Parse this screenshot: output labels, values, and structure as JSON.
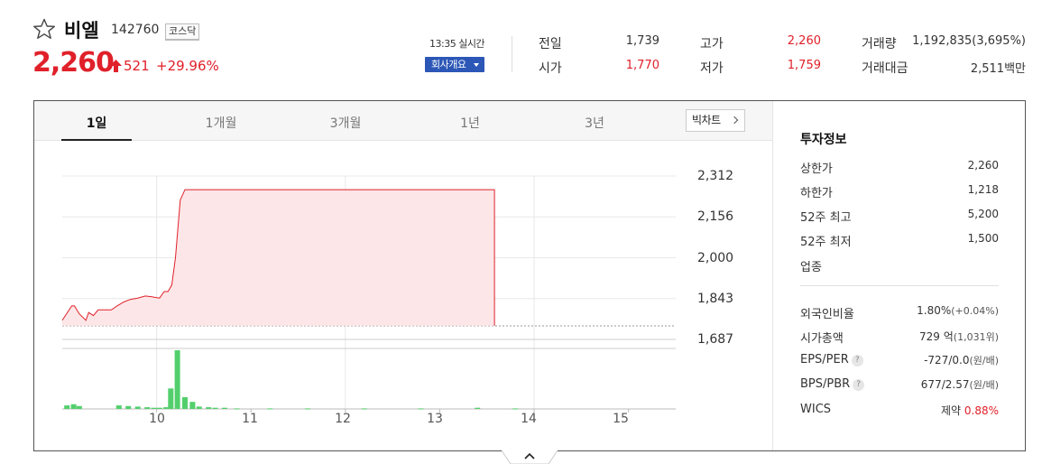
{
  "stock": {
    "name": "비엘",
    "code": "142760",
    "market": "코스닥",
    "price": "2,260",
    "change": "521",
    "change_rate": "+29.96%",
    "time": "13:35 실시간",
    "company_button": "회사개요"
  },
  "summary": {
    "prev_close_label": "전일",
    "prev_close": "1,739",
    "open_label": "시가",
    "open": "1,770",
    "high_label": "고가",
    "high": "2,260",
    "low_label": "저가",
    "low": "1,759",
    "volume_label": "거래량",
    "volume": "1,192,835(3,695%)",
    "amount_label": "거래대금",
    "amount": "2,511백만"
  },
  "tabs": [
    "1일",
    "1개월",
    "3개월",
    "1년",
    "3년"
  ],
  "bigchart_label": "빅차트",
  "colors": {
    "up": "#e0202a",
    "down": "#2354c8",
    "accent": "#2c57b7",
    "volume": "#52cf6c"
  },
  "chart_data": {
    "type": "line",
    "title": "",
    "xlabel": "",
    "ylabel": "",
    "y_ticks": [
      "2,312",
      "2,156",
      "2,000",
      "1,843",
      "1,687"
    ],
    "x_ticks": [
      "10",
      "11",
      "12",
      "13",
      "14",
      "15"
    ],
    "ylim": [
      1687,
      2312
    ],
    "xlim_hours": [
      9.0,
      15.5
    ],
    "prev_close": 1739,
    "price_series": {
      "x": [
        9.0,
        9.1,
        9.13,
        9.18,
        9.25,
        9.28,
        9.33,
        9.38,
        9.45,
        9.52,
        9.58,
        9.65,
        9.72,
        9.8,
        9.88,
        9.95,
        10.0,
        10.03,
        10.08,
        10.12,
        10.16,
        10.2,
        10.25,
        10.3,
        10.4,
        10.6,
        11.0,
        12.0,
        13.0,
        13.58
      ],
      "y": [
        1760,
        1815,
        1815,
        1785,
        1760,
        1790,
        1778,
        1800,
        1800,
        1800,
        1815,
        1830,
        1840,
        1845,
        1853,
        1850,
        1847,
        1845,
        1870,
        1870,
        1895,
        2000,
        2220,
        2260,
        2260,
        2260,
        2260,
        2260,
        2260,
        2260
      ]
    },
    "volume_series": {
      "x": [
        9.05,
        9.12,
        9.18,
        9.6,
        9.7,
        9.8,
        9.9,
        9.97,
        10.03,
        10.1,
        10.15,
        10.22,
        10.3,
        10.38,
        10.45,
        10.55,
        10.62,
        10.72,
        10.85,
        11.2,
        11.6,
        12.2,
        12.8,
        13.4,
        13.8
      ],
      "v": [
        6,
        8,
        5,
        6,
        5,
        4,
        3,
        2,
        2,
        3,
        35,
        100,
        20,
        12,
        4,
        3,
        2,
        2,
        1,
        1,
        1,
        1,
        1,
        2,
        1
      ],
      "ylim": [
        0,
        100
      ]
    }
  },
  "info": {
    "title": "투자정보",
    "rows": [
      {
        "label": "상한가",
        "value": "2,260"
      },
      {
        "label": "하한가",
        "value": "1,218"
      },
      {
        "label": "52주 최고",
        "value": "5,200"
      },
      {
        "label": "52주 최저",
        "value": "1,500"
      },
      {
        "label": "업종",
        "value": ""
      }
    ],
    "foreign_label": "외국인비율",
    "foreign_value": "1.80%",
    "foreign_sub": "(+0.04%)",
    "mktcap_label": "시가총액",
    "mktcap_value": "729",
    "mktcap_unit": "억",
    "mktcap_sub": "(1,031위)",
    "eps_label": "EPS/PER",
    "eps_value": "-727/0.0",
    "eps_sub": "(원/배)",
    "bps_label": "BPS/PBR",
    "bps_value": "677/2.57",
    "bps_sub": "(원/배)",
    "wics_label": "WICS",
    "wics_sector": "제약",
    "wics_rate": "0.88%"
  }
}
